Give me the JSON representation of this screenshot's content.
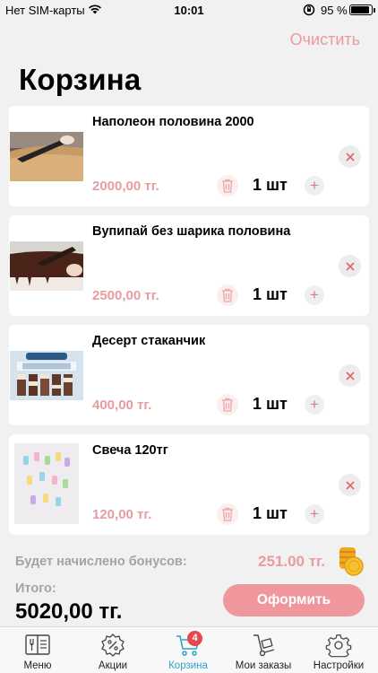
{
  "status_bar": {
    "carrier": "Нет SIM-карты",
    "time": "10:01",
    "battery_percent": "95 %",
    "battery_level": 0.95
  },
  "header": {
    "clear_label": "Очистить",
    "title": "Корзина"
  },
  "cart": {
    "items": [
      {
        "name": "Наполеон половина 2000",
        "price": "2000,00 тг.",
        "quantity": "1 шт",
        "image": "napoleon-cake"
      },
      {
        "name": "Вупипай без шарика половина",
        "price": "2500,00 тг.",
        "quantity": "1 шт",
        "image": "chocolate-cake"
      },
      {
        "name": "Десерт стаканчик",
        "price": "400,00 тг.",
        "quantity": "1 шт",
        "image": "dessert-cups"
      },
      {
        "name": "Свеча 120тг",
        "price": "120,00 тг.",
        "quantity": "1 шт",
        "image": "candles"
      }
    ]
  },
  "summary": {
    "bonus_label": "Будет начислено бонусов:",
    "bonus_value": "251.00 тг.",
    "total_label": "Итого:",
    "total_value": "5020,00 тг.",
    "checkout_label": "Оформить"
  },
  "tabbar": {
    "tabs": [
      {
        "label": "Меню",
        "icon": "menu-book-icon"
      },
      {
        "label": "Акции",
        "icon": "discount-badge-icon"
      },
      {
        "label": "Корзина",
        "icon": "cart-icon",
        "badge": "4",
        "active": true
      },
      {
        "label": "Мои заказы",
        "icon": "hand-truck-icon"
      },
      {
        "label": "Настройки",
        "icon": "gear-icon"
      }
    ]
  },
  "colors": {
    "accent_pink": "#f0979d",
    "price_pink": "#e89ca0",
    "active_tab": "#2da3c8",
    "badge": "#e5484f",
    "background": "#f2f1f1"
  }
}
